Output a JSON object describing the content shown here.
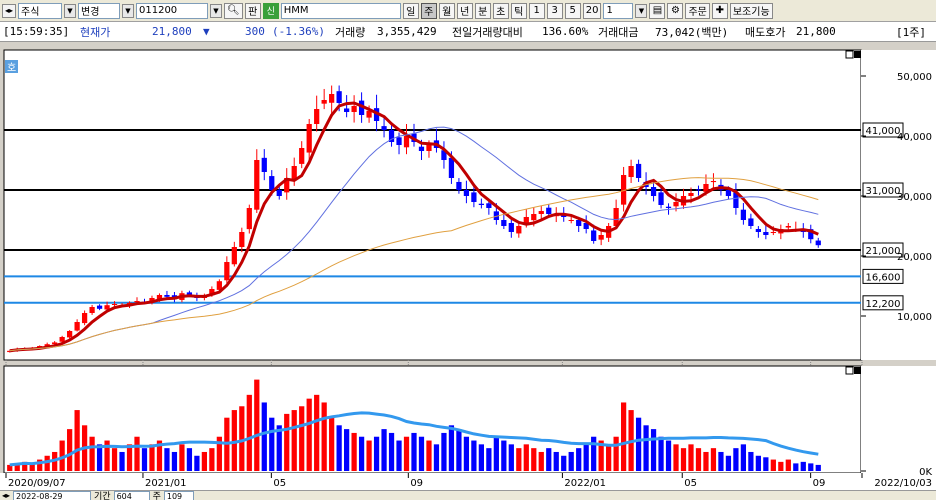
{
  "toolbar": {
    "market": "주식",
    "change_label": "변경",
    "code": "011200",
    "pan": "판",
    "sin": "신",
    "name": "HMM",
    "periods": [
      "일",
      "주",
      "월",
      "년",
      "분",
      "초",
      "틱"
    ],
    "active_period": "주",
    "numbers": [
      "1",
      "3",
      "5",
      "20"
    ],
    "count": "1",
    "order_label": "주문",
    "aux_label": "보조기능"
  },
  "infobar": {
    "time": "[15:59:35]",
    "price_label": "현재가",
    "price": "21,800",
    "arrow": "▼",
    "change": "300",
    "change_pct": "(-1.36%)",
    "volume_label": "거래량",
    "volume": "3,355,429",
    "prev_ratio_label": "전일거래량대비",
    "prev_ratio": "136.60%",
    "amount_label": "거래대금",
    "amount": "73,042(백만)",
    "ask_label": "매도호가",
    "ask": "21,800",
    "page": "[1주]"
  },
  "chart_badge": "호",
  "chart_data": {
    "type": "candlestick",
    "frequency": "weekly",
    "x_ticks": [
      "2020/09/07",
      "2021/01",
      "05",
      "09",
      "2022/01",
      "05",
      "09",
      "2022/10/03"
    ],
    "y_ticks": [
      "50,000",
      "40,000",
      "30,000",
      "20,000",
      "10,000"
    ],
    "ylim": [
      3000,
      54000
    ],
    "price_levels": [
      {
        "value": 41000,
        "label": "41,000",
        "color": "#000000"
      },
      {
        "value": 31000,
        "label": "31,000",
        "color": "#000000"
      },
      {
        "value": 21000,
        "label": "21,000",
        "color": "#000000"
      },
      {
        "value": 16600,
        "label": "16,600",
        "color": "#1e88e5"
      },
      {
        "value": 12200,
        "label": "12,200",
        "color": "#1e88e5"
      }
    ],
    "close": [
      4200,
      4500,
      4600,
      4700,
      5000,
      5300,
      5600,
      6500,
      7500,
      9000,
      10500,
      11500,
      11200,
      11800,
      12000,
      11800,
      12200,
      12500,
      12300,
      13000,
      13500,
      13200,
      12800,
      13800,
      13500,
      13000,
      13200,
      14500,
      15800,
      19000,
      21500,
      24000,
      28000,
      36000,
      34000,
      31000,
      30000,
      33000,
      35000,
      38000,
      42000,
      44500,
      46000,
      47000,
      45500,
      44000,
      45000,
      43500,
      44200,
      42500,
      41000,
      39000,
      38500,
      40000,
      39000,
      37500,
      38500,
      38000,
      36000,
      33000,
      31000,
      30000,
      29000,
      28500,
      28000,
      26000,
      25000,
      24000,
      25000,
      26500,
      27000,
      27500,
      27000,
      26800,
      26500,
      26000,
      25000,
      24500,
      22500,
      23500,
      25000,
      28000,
      33500,
      35000,
      33000,
      31500,
      30000,
      28500,
      28000,
      29000,
      30000,
      30500,
      31000,
      32000,
      32500,
      31000,
      30000,
      28000,
      26000,
      25000,
      24000,
      23500,
      24000,
      24500,
      25000,
      24500,
      24000,
      22800,
      21800
    ],
    "ma": [
      {
        "name": "MA5",
        "color": "#c00000",
        "width": 3,
        "period": 5
      },
      {
        "name": "MA20",
        "color": "#6070e0",
        "width": 1,
        "period": 20
      },
      {
        "name": "MA60",
        "color": "#e0a040",
        "width": 1,
        "period": 60
      }
    ],
    "volume_ticks": [
      "100,000K",
      "50,000K",
      "0K"
    ],
    "volume_ylim": [
      0,
      130000
    ],
    "volume": [
      8,
      10,
      12,
      9,
      15,
      20,
      25,
      40,
      55,
      80,
      60,
      45,
      35,
      40,
      30,
      25,
      35,
      45,
      30,
      35,
      40,
      30,
      25,
      35,
      30,
      20,
      25,
      30,
      45,
      70,
      80,
      85,
      100,
      120,
      90,
      70,
      60,
      75,
      80,
      85,
      95,
      100,
      90,
      70,
      60,
      55,
      50,
      45,
      40,
      45,
      55,
      50,
      40,
      45,
      50,
      45,
      40,
      35,
      50,
      60,
      55,
      45,
      40,
      35,
      30,
      45,
      40,
      35,
      30,
      35,
      30,
      25,
      30,
      25,
      20,
      25,
      30,
      35,
      45,
      40,
      35,
      45,
      90,
      80,
      70,
      60,
      55,
      45,
      40,
      35,
      30,
      35,
      30,
      25,
      30,
      25,
      20,
      30,
      35,
      25,
      20,
      18,
      15,
      12,
      15,
      10,
      12,
      10,
      8
    ],
    "volume_ma_color": "#3399ee",
    "volume_ma_label": "volume MA"
  },
  "bottombar": {
    "date": "2022-08-29",
    "period_label": "기간",
    "period_value": "604",
    "unit_label": "주",
    "count_value": "109"
  },
  "colors": {
    "up": "#ff0000",
    "down": "#0000ff",
    "background": "#ffffff"
  }
}
